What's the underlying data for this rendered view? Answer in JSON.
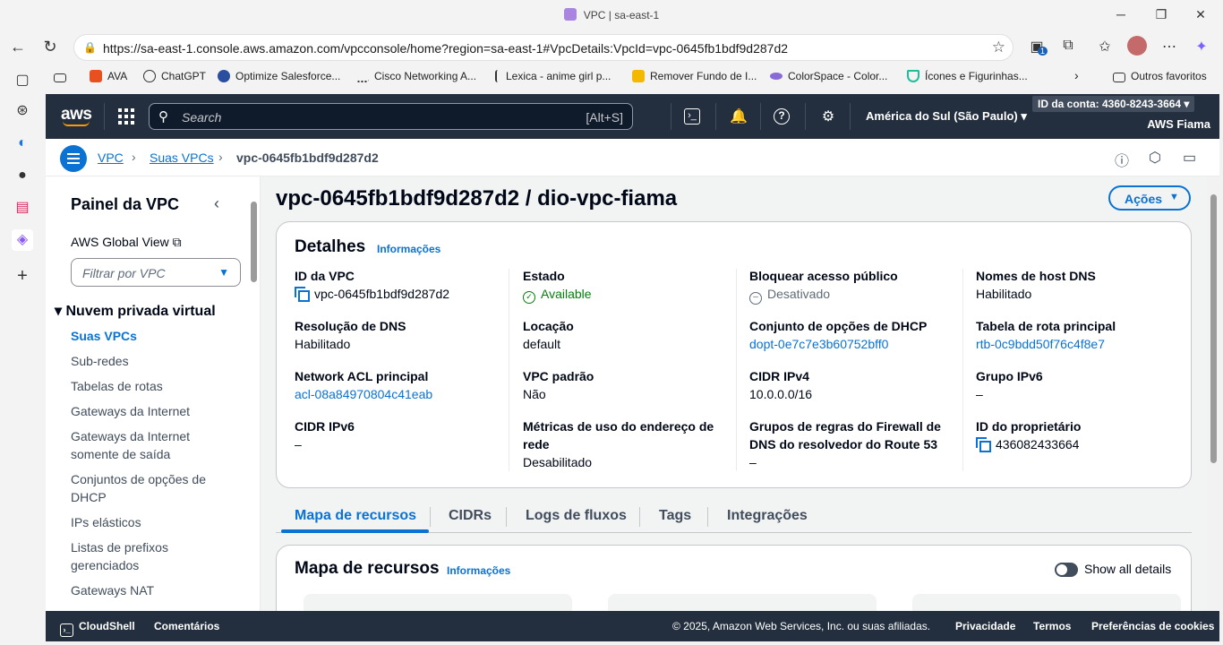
{
  "browser": {
    "window_title": "VPC | sa-east-1",
    "url": "https://sa-east-1.console.aws.amazon.com/vpcconsole/home?region=sa-east-1#VpcDetails:VpcId=vpc-0645fb1bdf9d287d2",
    "notification_badge": "1",
    "bookmarks": [
      "AVA",
      "ChatGPT",
      "Optimize Salesforce...",
      "Cisco Networking A...",
      "Lexica - anime girl p...",
      "Remover Fundo de I...",
      "ColorSpace - Color...",
      "Ícones e Figurinhas..."
    ],
    "other_favorites": "Outros favoritos"
  },
  "aws_nav": {
    "logo": "aws",
    "search_placeholder": "Search",
    "search_shortcut": "[Alt+S]",
    "region": "América do Sul (São Paulo)",
    "account_id": "ID da conta: 4360-8243-3664",
    "account_name": "AWS Fiama"
  },
  "breadcrumb": {
    "items": [
      "VPC",
      "Suas VPCs",
      "vpc-0645fb1bdf9d287d2"
    ]
  },
  "sidenav": {
    "title": "Painel da VPC",
    "global_view": "AWS Global View",
    "filter_placeholder": "Filtrar por VPC",
    "section": "Nuvem privada virtual",
    "items": [
      "Suas VPCs",
      "Sub-redes",
      "Tabelas de rotas",
      "Gateways da Internet",
      "Gateways da Internet somente de saída",
      "Conjuntos de opções de DHCP",
      "IPs elásticos",
      "Listas de prefixos gerenciados",
      "Gateways NAT"
    ]
  },
  "main": {
    "title": "vpc-0645fb1bdf9d287d2 / dio-vpc-fiama",
    "actions_label": "Ações",
    "details_heading": "Detalhes",
    "info_label": "Informações",
    "details": [
      [
        {
          "k": "ID da VPC",
          "v": "vpc-0645fb1bdf9d287d2"
        },
        {
          "k": "Resolução de DNS",
          "v": "Habilitado"
        },
        {
          "k": "Network ACL principal",
          "v": "acl-08a84970804c41eab"
        },
        {
          "k": "CIDR IPv6",
          "v": "–"
        }
      ],
      [
        {
          "k": "Estado",
          "v": "Available"
        },
        {
          "k": "Locação",
          "v": "default"
        },
        {
          "k": "VPC padrão",
          "v": "Não"
        },
        {
          "k": "Métricas de uso do endereço de rede",
          "v": "Desabilitado"
        }
      ],
      [
        {
          "k": "Bloquear acesso público",
          "v": "Desativado"
        },
        {
          "k": "Conjunto de opções de DHCP",
          "v": "dopt-0e7c7e3b60752bff0"
        },
        {
          "k": "CIDR IPv4",
          "v": "10.0.0.0/16"
        },
        {
          "k": "Grupos de regras do Firewall de DNS do resolvedor do Route 53",
          "v": "–"
        }
      ],
      [
        {
          "k": "Nomes de host DNS",
          "v": "Habilitado"
        },
        {
          "k": "Tabela de rota principal",
          "v": "rtb-0c9bdd50f76c4f8e7"
        },
        {
          "k": "Grupo IPv6",
          "v": "–"
        },
        {
          "k": "ID do proprietário",
          "v": "436082433664"
        }
      ]
    ],
    "tabs": [
      "Mapa de recursos",
      "CIDRs",
      "Logs de fluxos",
      "Tags",
      "Integrações"
    ],
    "resource_map_heading": "Mapa de recursos",
    "show_all_details": "Show all details"
  },
  "footer": {
    "cloudshell": "CloudShell",
    "comments": "Comentários",
    "copyright": "© 2025, Amazon Web Services, Inc. ou suas afiliadas.",
    "privacy": "Privacidade",
    "terms": "Termos",
    "cookies": "Preferências de cookies"
  }
}
